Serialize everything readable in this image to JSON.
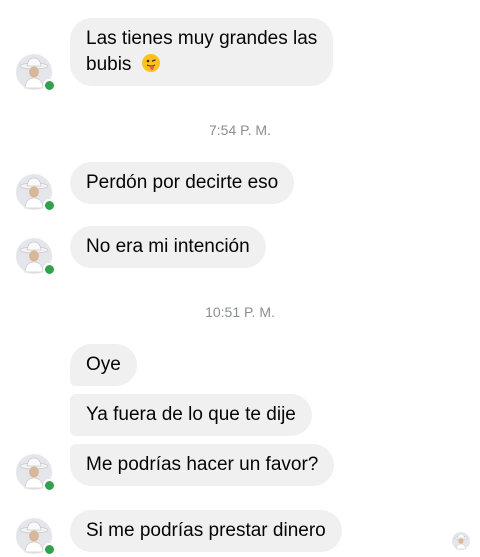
{
  "colors": {
    "bubble_bg": "#f0f0f0",
    "text": "#050505",
    "timestamp": "#8a8d91",
    "online": "#31a24c"
  },
  "messages": [
    {
      "line1": "Las tienes muy grandes las",
      "line2": "bubis",
      "emoji": "face-with-tongue-icon"
    },
    {
      "text": "Perdón por decirte eso"
    },
    {
      "text": "No era mi intención"
    },
    {
      "text": "Oye"
    },
    {
      "text": "Ya fuera de lo que te dije"
    },
    {
      "text": "Me podrías hacer un favor?"
    },
    {
      "text": "Si me podrías prestar dinero"
    }
  ],
  "timestamps": [
    "7:54 P. M.",
    "10:51 P. M."
  ],
  "avatar_icon": "cowboy-hat-profile-icon",
  "seen_indicator_icon": "seen-avatar-icon"
}
